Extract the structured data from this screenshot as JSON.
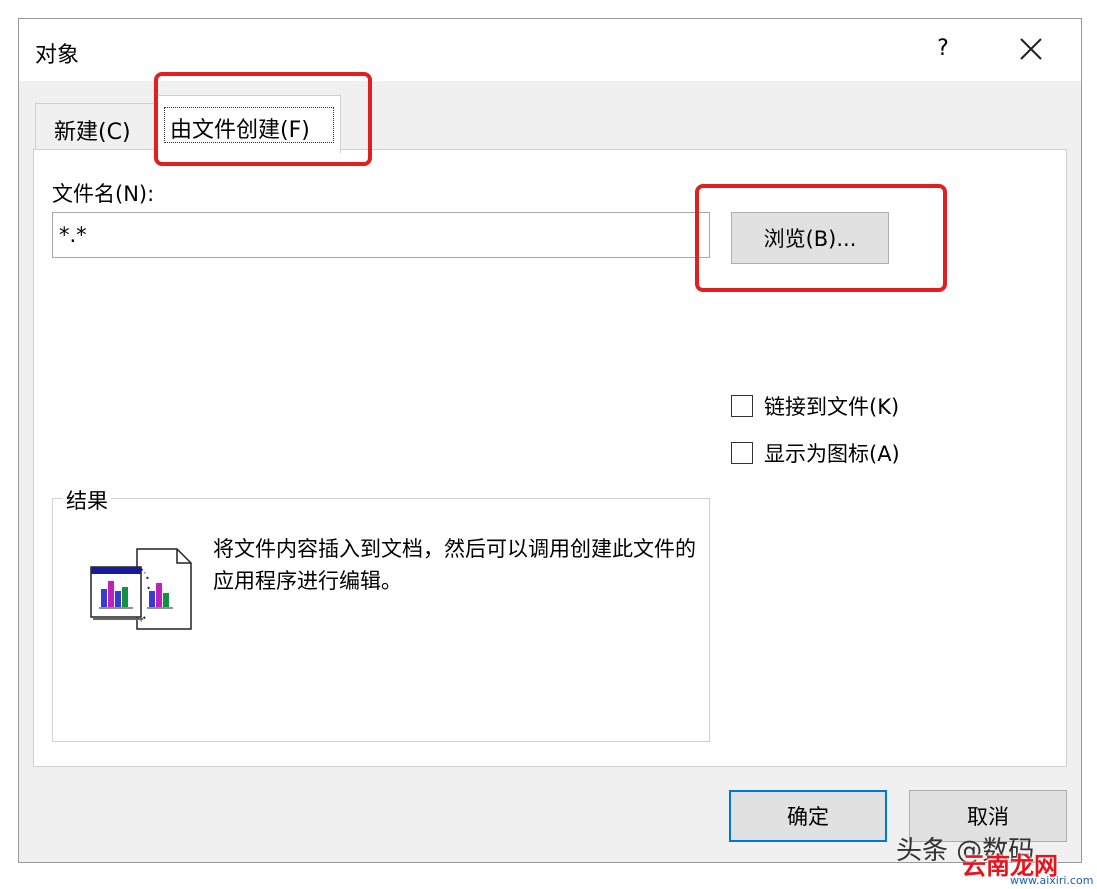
{
  "window": {
    "title": "对象",
    "help_label": "?"
  },
  "tabs": [
    {
      "label": "新建(C)",
      "mnemonic": "C"
    },
    {
      "label": "由文件创建(F)",
      "mnemonic": "F"
    }
  ],
  "form": {
    "filename_label": "文件名(N):",
    "filename_value": "*.*",
    "browse_label": "浏览(B)..."
  },
  "options": {
    "link_label": "链接到文件(K)",
    "link_checked": false,
    "show_icon_label": "显示为图标(A)",
    "show_icon_checked": false
  },
  "result": {
    "legend": "结果",
    "text": "将文件内容插入到文档，然后可以调用创建此文件的应用程序进行编辑。",
    "icon": "file-insert-icon"
  },
  "buttons": {
    "ok_label": "确定",
    "cancel_label": "取消"
  },
  "watermarks": {
    "toutiao": "头条 @数码",
    "site": "云南龙网",
    "url": "www.aixiri.com"
  },
  "colors": {
    "highlight": "#e02020",
    "default_button_border": "#0078d7",
    "dialog_bg": "#f0f0f0"
  }
}
